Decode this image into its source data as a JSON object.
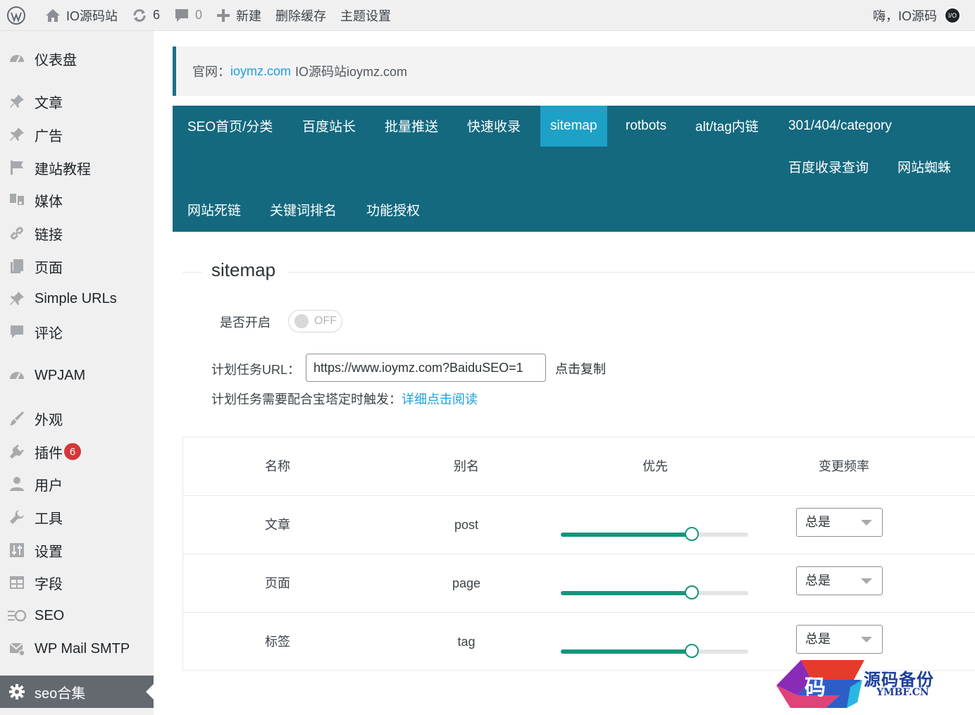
{
  "admin_bar": {
    "site_name": "IO源码站",
    "updates_count": "6",
    "comments_count": "0",
    "new_label": "新建",
    "clear_cache_label": "删除缓存",
    "theme_settings_label": "主题设置",
    "greeting": "嗨，IO源码",
    "avatar_text": "I/O"
  },
  "sidebar": {
    "items": [
      {
        "label": "仪表盘",
        "icon": "dashboard-icon"
      },
      {
        "label": "文章",
        "icon": "pin-icon"
      },
      {
        "label": "广告",
        "icon": "pin-icon"
      },
      {
        "label": "建站教程",
        "icon": "flag-icon"
      },
      {
        "label": "媒体",
        "icon": "media-icon"
      },
      {
        "label": "链接",
        "icon": "link-icon"
      },
      {
        "label": "页面",
        "icon": "pages-icon"
      },
      {
        "label": "Simple URLs",
        "icon": "pin-icon"
      },
      {
        "label": "评论",
        "icon": "comment-icon"
      },
      {
        "label": "WPJAM",
        "icon": "dashboard-icon"
      },
      {
        "label": "外观",
        "icon": "brush-icon"
      },
      {
        "label": "插件",
        "icon": "plugin-icon",
        "badge": "6"
      },
      {
        "label": "用户",
        "icon": "user-icon"
      },
      {
        "label": "工具",
        "icon": "wrench-icon"
      },
      {
        "label": "设置",
        "icon": "settings-icon"
      },
      {
        "label": "字段",
        "icon": "table-icon"
      },
      {
        "label": "SEO",
        "icon": "seo-icon"
      },
      {
        "label": "WP Mail SMTP",
        "icon": "mail-icon"
      },
      {
        "label": "seo合集",
        "icon": "gear-icon",
        "current": true
      }
    ]
  },
  "notice": {
    "prefix": "官网：",
    "link_text": "ioymz.com",
    "suffix": "IO源码站ioymz.com"
  },
  "tabs": [
    {
      "label": "SEO首页/分类"
    },
    {
      "label": "百度站长"
    },
    {
      "label": "批量推送"
    },
    {
      "label": "快速收录"
    },
    {
      "label": "sitemap",
      "active": true
    },
    {
      "label": "rotbots"
    },
    {
      "label": "alt/tag内链"
    },
    {
      "label": "301/404/category"
    },
    {
      "label": "百度收录查询"
    },
    {
      "label": "网站蜘蛛"
    },
    {
      "label": "网站死链"
    },
    {
      "label": "关键词排名"
    },
    {
      "label": "功能授权"
    }
  ],
  "section": {
    "title": "sitemap",
    "enable_label": "是否开启",
    "toggle_state": "OFF",
    "cron_url_label": "计划任务URL：",
    "cron_url_value": "https://www.ioymz.com?BaiduSEO=1",
    "copy_label": "点击复制",
    "cron_note": "计划任务需要配合宝塔定时触发：",
    "read_link": "详细点击阅读"
  },
  "table": {
    "headers": [
      "名称",
      "别名",
      "优先",
      "变更频率"
    ],
    "rows": [
      {
        "name": "文章",
        "alias": "post",
        "priority": 0.7,
        "frequency": "总是"
      },
      {
        "name": "页面",
        "alias": "page",
        "priority": 0.7,
        "frequency": "总是"
      },
      {
        "name": "标签",
        "alias": "tag",
        "priority": 0.7,
        "frequency": "总是"
      }
    ]
  },
  "watermark": {
    "glyph": "码",
    "main": "源码备份",
    "sub": "YMBF.CN"
  },
  "colors": {
    "tab_bg": "#14697f",
    "tab_active": "#1ea1c6",
    "link": "#1e9fdc",
    "slider": "#16957b",
    "badge": "#d63638"
  }
}
